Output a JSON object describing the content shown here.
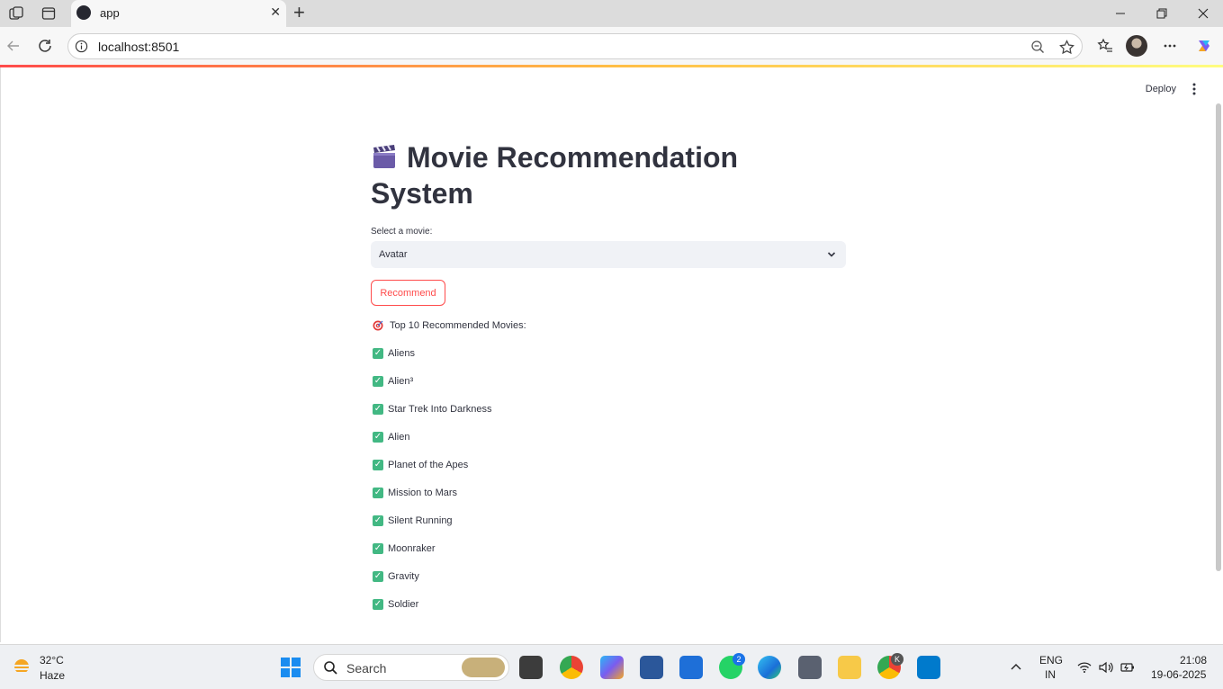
{
  "browser": {
    "tab_title": "app",
    "url": "localhost:8501"
  },
  "app": {
    "header": {
      "deploy_label": "Deploy"
    },
    "title": "Movie Recommendation System",
    "select": {
      "label": "Select a movie:",
      "value": "Avatar"
    },
    "recommend_button": "Recommend",
    "results_heading": "Top 10 Recommended Movies:",
    "movies": [
      "Aliens",
      "Alien³",
      "Star Trek Into Darkness",
      "Alien",
      "Planet of the Apes",
      "Mission to Mars",
      "Silent Running",
      "Moonraker",
      "Gravity",
      "Soldier"
    ],
    "accent_color": "#ff4b4b"
  },
  "taskbar": {
    "weather": {
      "temp": "32°C",
      "desc": "Haze"
    },
    "search_placeholder": "Search",
    "whatsapp_badge": "2",
    "chrome_badge": "K",
    "lang_top": "ENG",
    "lang_bottom": "IN",
    "time": "21:08",
    "date": "19-06-2025"
  }
}
